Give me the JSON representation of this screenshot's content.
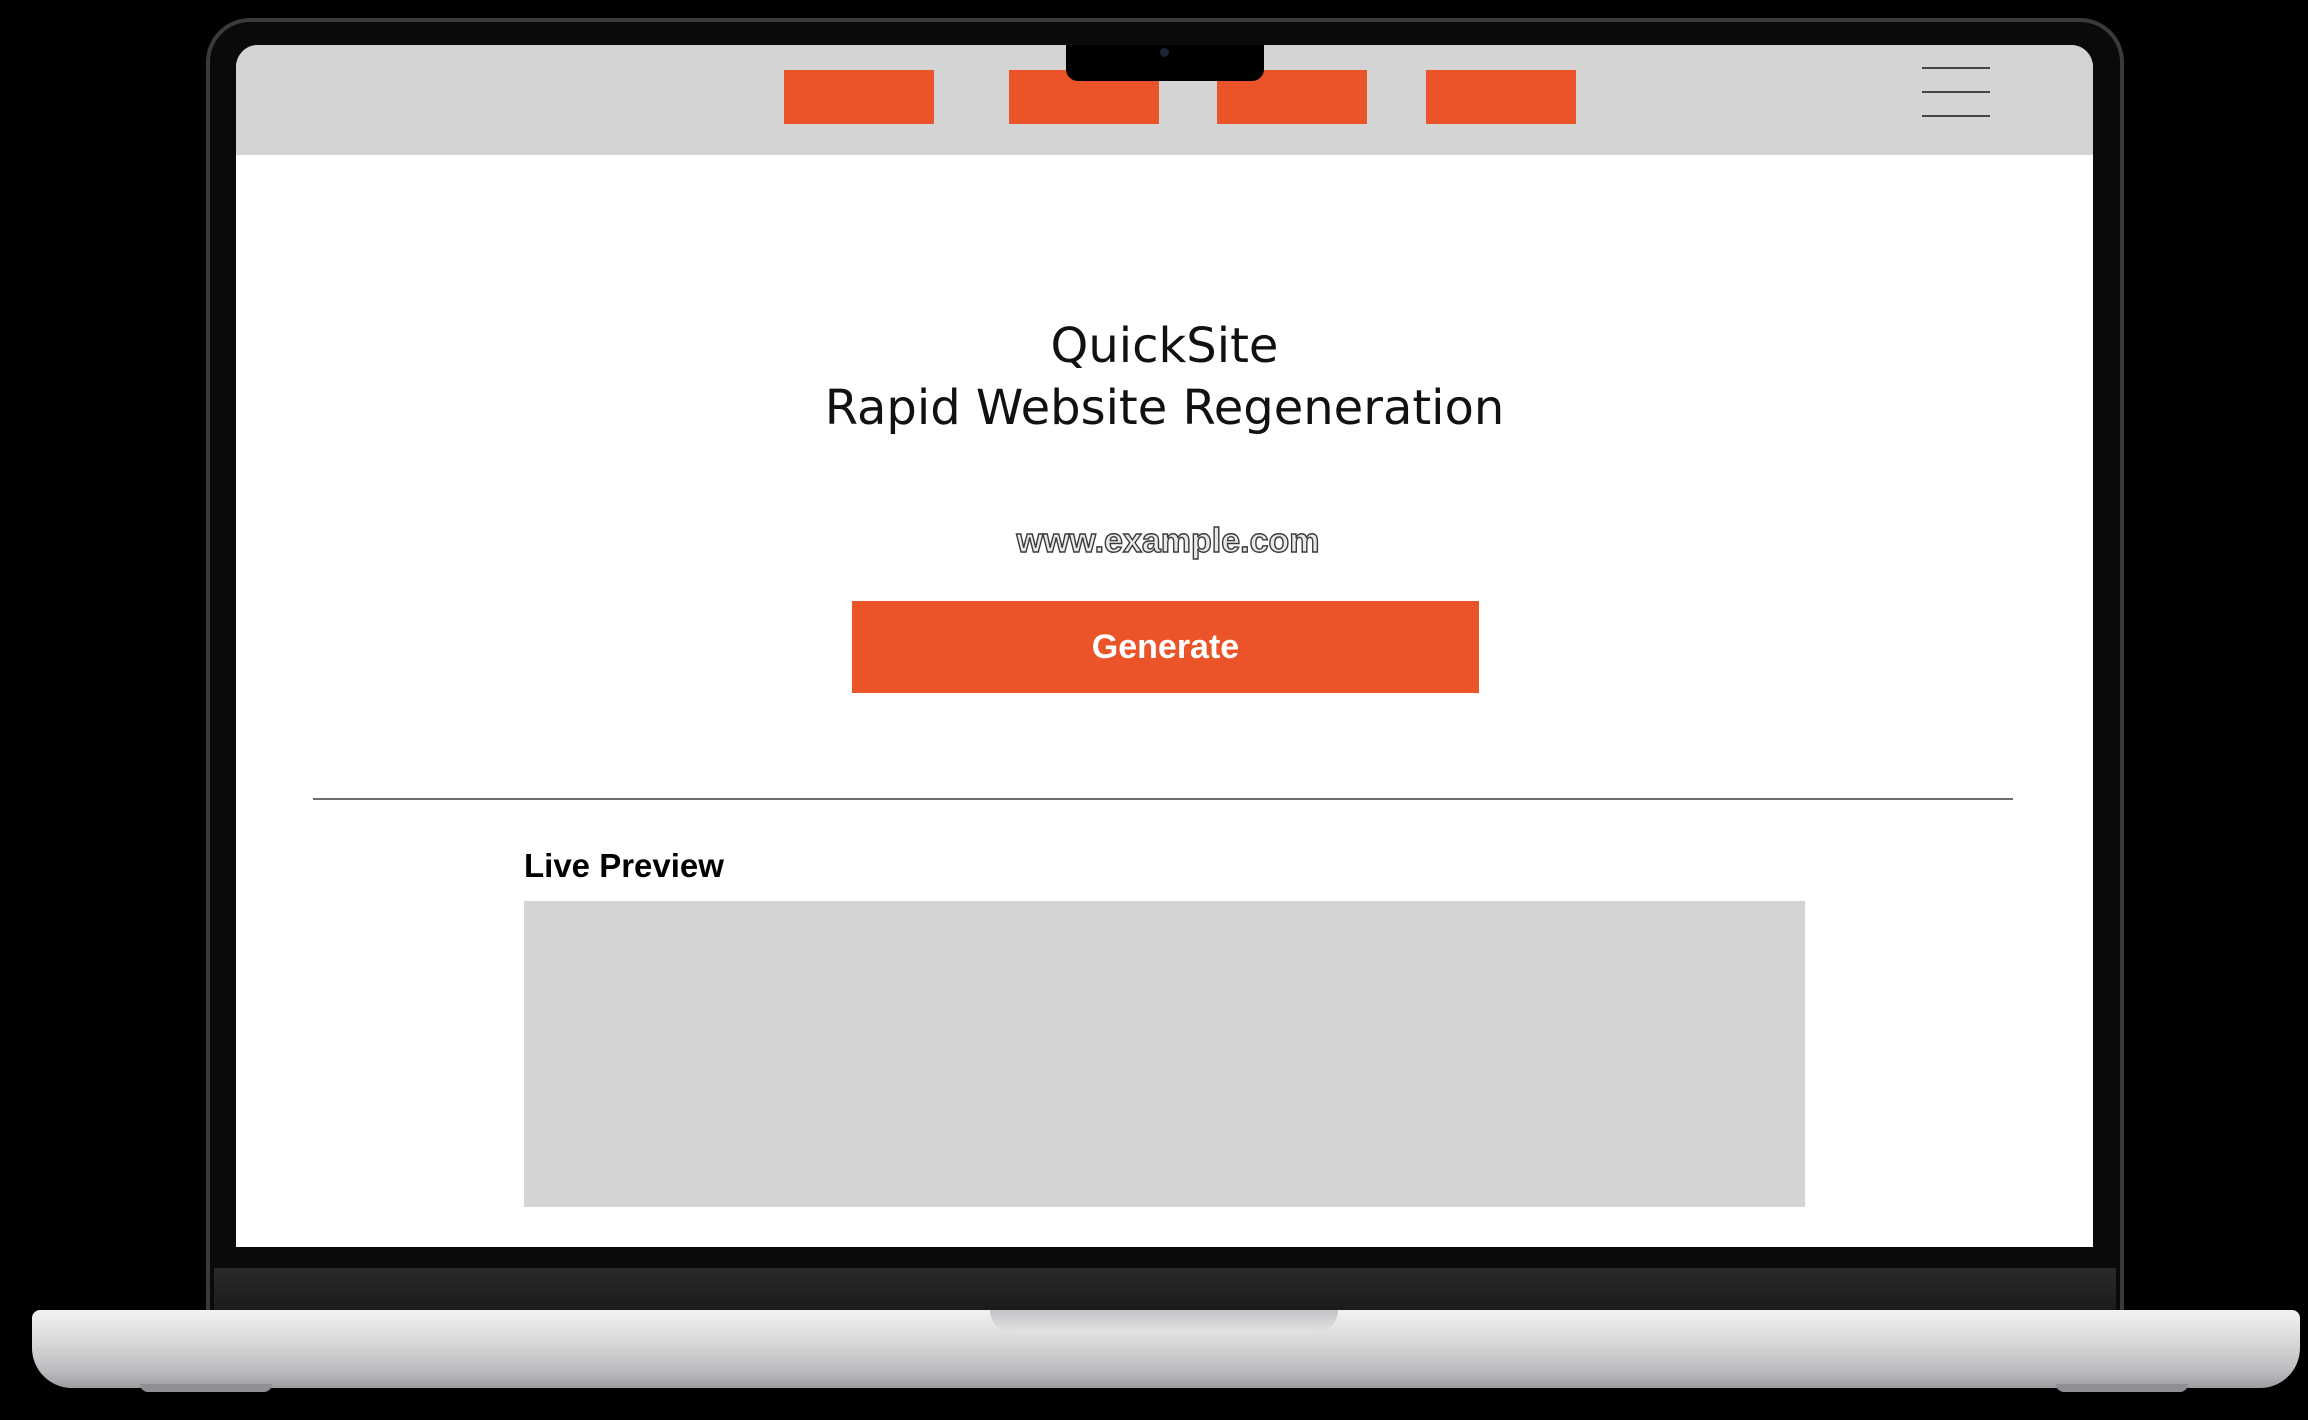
{
  "nav": {
    "items": [
      "",
      "",
      "",
      ""
    ]
  },
  "hero": {
    "title_line1": "QuickSite",
    "title_line2": "Rapid Website Regeneration"
  },
  "url_input": {
    "value": "www.example.com"
  },
  "generate_button": {
    "label": "Generate"
  },
  "preview": {
    "label": "Live Preview"
  },
  "colors": {
    "accent": "#eb5428",
    "topbar": "#d4d4d4",
    "preview_bg": "#d4d4d4"
  },
  "icons": {
    "menu": "hamburger-menu-icon"
  }
}
